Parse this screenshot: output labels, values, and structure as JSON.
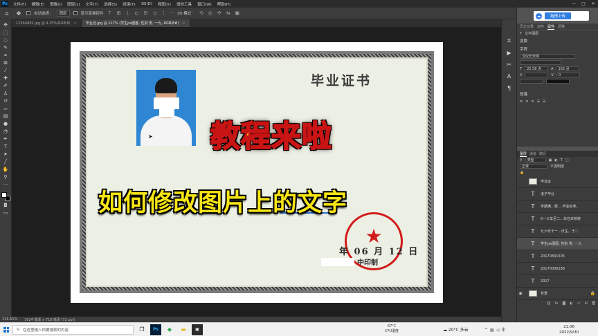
{
  "menu": {
    "app_logo": "Ps",
    "items": [
      "文件(F)",
      "编辑(E)",
      "图像(I)",
      "图层(L)",
      "文字(Y)",
      "选择(S)",
      "滤镜(T)",
      "3D(D)",
      "视图(V)",
      "增效工具",
      "窗口(W)",
      "帮助(H)"
    ],
    "window_controls": [
      "—",
      "□",
      "✕"
    ]
  },
  "options": {
    "auto_select_label": "自动选择：",
    "layer_select": "图层",
    "show_transform_label": "显示变换控件",
    "more": "···",
    "mode_3d": "3D 模式："
  },
  "tabs": [
    {
      "label": "123A5882.jpg @ 9.25%(RGB/8)"
    },
    {
      "label": "毕业证.jpg @ 117% (学生pe图图, 性别 男, 一九, RGB/8#)"
    }
  ],
  "certificate": {
    "title": "毕业证书",
    "promo_line1": "教程来啦",
    "promo_line2": "如何修改图片上的文字",
    "date_line": "年 06 月 12 日",
    "school_suffix": "中印制",
    "seal_star": "★"
  },
  "status": {
    "zoom": "116.61%",
    "doc_size": "1024 像素 x 718 像素 (72 ppi)"
  },
  "cloud": {
    "logo": "☁",
    "button": "拖拽上传"
  },
  "panel_tabs": [
    "历史记录",
    "动作",
    "属性",
    "调整"
  ],
  "properties": {
    "layer_type": "文字图层",
    "transform_label": "变换",
    "char_label": "字符",
    "font_family": "汉仪长宋简",
    "font_size": "25.58 点",
    "leading": "162 点",
    "tracking": "0",
    "paragraph_label": "段落"
  },
  "layers_panel": {
    "tabs": [
      "图层",
      "通道",
      "路径"
    ],
    "filter_label": "类型",
    "blend_mode": "正常",
    "opacity_label": "不透明度",
    "layers": [
      {
        "name": "学生pe图图, 性别 男, 一九",
        "type": "text",
        "selected": true
      },
      {
        "name": "毕业证",
        "type": "image",
        "selected": false
      },
      {
        "name": "凌子毕业 -",
        "type": "text",
        "selected": false
      },
      {
        "name": "学期满，经 ...毕业标准，",
        "type": "text",
        "selected": false
      },
      {
        "name": "0一三年至二...年在本校修",
        "type": "text",
        "selected": false
      },
      {
        "name": "九六年十一...日生，于二",
        "type": "text",
        "selected": false
      },
      {
        "name": "学生pe图图, 性别 男, 一九",
        "type": "text",
        "selected": true
      },
      {
        "name": "20170801505",
        "type": "text",
        "selected": false
      },
      {
        "name": "20170000188",
        "type": "text",
        "selected": false
      },
      {
        "name": "2017",
        "type": "text",
        "selected": false
      },
      {
        "name": "背景",
        "type": "image",
        "selected": false
      }
    ]
  },
  "taskbar": {
    "search_placeholder": "在这里输入你要搜索的内容",
    "cpu_temp": "67°C",
    "cpu_label": "CPU温度",
    "weather": "20°C 多云",
    "time": "21:06",
    "date": "2022/9/30"
  }
}
